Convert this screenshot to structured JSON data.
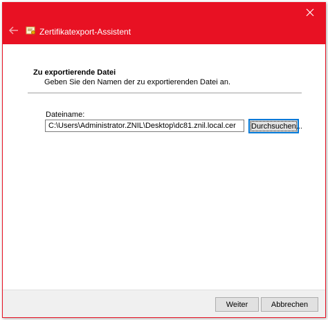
{
  "window": {
    "title": "Zertifikatexport-Assistent",
    "accent_color": "#e81123",
    "icons": {
      "close": "close-icon",
      "back": "arrow-left-icon",
      "app": "certificate-icon"
    }
  },
  "page": {
    "section_title": "Zu exportierende Datei",
    "section_description": "Geben Sie den Namen der zu exportierenden Datei an.",
    "filename_label": "Dateiname:",
    "filename_value": "C:\\Users\\Administrator.ZNIL\\Desktop\\dc81.znil.local.cer",
    "browse_label": "Durchsuchen..."
  },
  "footer": {
    "next_label": "Weiter",
    "cancel_label": "Abbrechen"
  }
}
